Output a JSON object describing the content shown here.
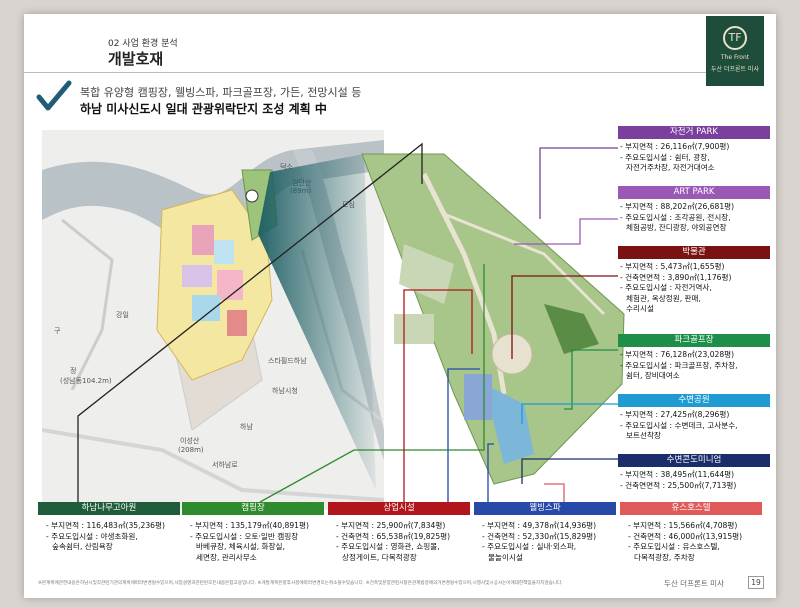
{
  "header": {
    "section": "02  사업 환경 분석",
    "title": "개발호재"
  },
  "logo": {
    "mark": "TF",
    "line1": "The Front",
    "line2": "두산 더프론트 미사"
  },
  "summary": {
    "line1": "복합 유양형 캠핑장, 웰빙스파, 파크골프장, 가든, 전망시설 등",
    "line2": "하남 미사신도시 일대 관광위락단지 조성 계획 中"
  },
  "map_labels": {
    "deokso": "덕소",
    "mtname": "검단산",
    "mtheight": "(89m)",
    "gangil": "강일",
    "hanam_city": "하남시청",
    "hanam": "하남",
    "iseongsan": "이성산",
    "iseongsan_h": "(208m)",
    "jeong": "정",
    "jeong_h": "(성남동104.2m)",
    "gu": "구",
    "starfield": "스타필드하남",
    "road1": "서하남로",
    "dosim": "도심"
  },
  "right_boxes": [
    {
      "title": "자전거 PARK",
      "color": "#7b3f9e",
      "rows": [
        "부지면적 : 26,116㎡(7,900평)",
        "주요도입시설 : 쉼터, 광장,",
        "자전거주차장, 자전거대여소"
      ]
    },
    {
      "title": "ART PARK",
      "color": "#9b59b6",
      "rows": [
        "부지면적 : 88,202㎡(26,681평)",
        "주요도입시설 : 조각공원, 전시장,",
        "체험공방, 잔디광장, 야외공연장"
      ]
    },
    {
      "title": "박물관",
      "color": "#7a1212",
      "rows": [
        "부지면적 : 5,473㎡(1,655평)",
        "건축연면적 : 3,890㎡(1,176평)",
        "주요도입시설 : 자전거역사,",
        "체험관, 옥상정원, 판매,",
        "수리시설"
      ]
    },
    {
      "title": "파크골프장",
      "color": "#1e8f4a",
      "rows": [
        "부지면적 : 76,128㎡(23,028평)",
        "주요도입시설 : 파크골프장, 주차장,",
        "쉼터, 장비대여소"
      ]
    },
    {
      "title": "수변공원",
      "color": "#1f9bd1",
      "rows": [
        "부지면적 : 27,425㎡(8,296평)",
        "주요도입시설 : 수변데크, 고사분수,",
        "보트선착장"
      ]
    },
    {
      "title": "수변콘도미니엄",
      "color": "#1b2e6b",
      "rows": [
        "부지면적 : 38,495㎡(11,644평)",
        "건축연면적 : 25,500㎡(7,713평)"
      ]
    }
  ],
  "bottom_boxes": [
    {
      "title": "하남나무고아원",
      "color": "#1f5c3a",
      "rows": [
        "부지면적 : 116,483㎡(35,236평)",
        "주요도입시설 : 야생초화원,",
        "숲속쉼터, 산림욕장"
      ]
    },
    {
      "title": "캠핑장",
      "color": "#2e8b2e",
      "rows": [
        "부지면적 : 135,179㎡(40,891평)",
        "주요도입시설 : 오토·일반 캠핑장",
        "바베큐장, 체육시설, 화장실,",
        "세면장, 관리사무소"
      ]
    },
    {
      "title": "상업시설",
      "color": "#b0161c",
      "rows": [
        "부지면적 : 25,900㎡(7,834평)",
        "건축면적 : 65,538㎡(19,825평)",
        "주요도입시설 : 영화관, 쇼핑몰,",
        "상정게이트, 다목적광장"
      ]
    },
    {
      "title": "웰빙스파",
      "color": "#2749a8",
      "rows": [
        "부지면적 : 49,378㎡(14,936평)",
        "건축면적 : 52,330㎡(15,829평)",
        "주요도입시설 : 실내·외스파,",
        "물놀이시설"
      ]
    },
    {
      "title": "유스호스텔",
      "color": "#e05a5a",
      "rows": [
        "부지면적 : 15,566㎡(4,708평)",
        "건축면적 : 46,000㎡(13,915평)",
        "주요도입시설 : 유스호스텔,",
        "다목적광장, 주차장"
      ]
    }
  ],
  "footer": {
    "note": "※본계획에관한내용은하남시및각관련기관의계획에따라변경될수있으며,사업설명과관련된모든내용은참고용입니다. ※개발계획은향후사정에따라변경또는취소될수있습니다. ※건축및분양관련사항은관계법령에의거변경될수있으며,시행사및시공사는이에대한책임을지지않습니다.",
    "brand": "두산 더프론트 미사",
    "page": "19"
  },
  "colors": {
    "logo_bg": "#1f4d3b",
    "river": "#b9c2c6",
    "park_green": "#7aa65a"
  }
}
